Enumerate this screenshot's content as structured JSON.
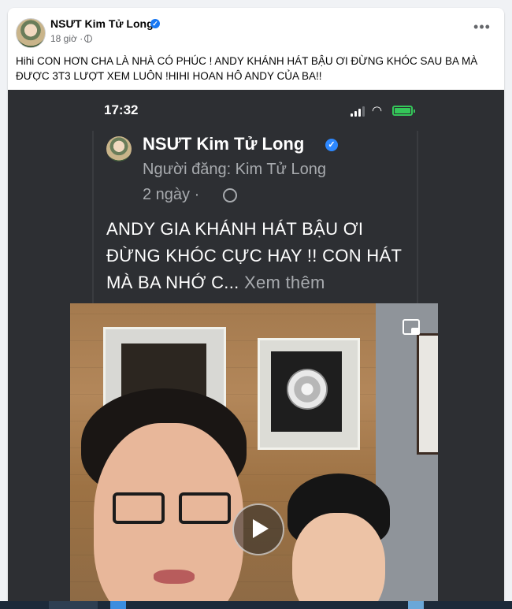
{
  "post": {
    "author": "NSƯT Kim Tử Long",
    "verified_mark": "✓",
    "time": "18 giờ ·",
    "more_label": "•••",
    "caption": "Hihi CON HƠN CHA LÀ NHÀ CÓ PHÚC ! ANDY KHÁNH HÁT BẬU ƠI ĐỪNG KHÓC SAU BA MÀ ĐƯỢC 3T3 LƯỢT XEM LUÔN !HIHI HOAN HÔ ANDY CỦA BA!!"
  },
  "screenshot": {
    "phone_time": "17:32",
    "inner_author": "NSƯT Kim Tử Long",
    "inner_poster": "Người đăng: Kim Tử Long",
    "inner_time": "2 ngày ·",
    "inner_text": "ANDY GIA KHÁNH HÁT BẬU ƠI ĐỪNG KHÓC CỰC HAY !! CON HÁT MÀ BA NHỚ C...",
    "see_more": "Xem thêm"
  },
  "icons": {
    "globe": "globe-icon",
    "verified": "verified-badge-icon",
    "play": "play-icon",
    "pip": "picture-in-picture-icon",
    "signal": "cellular-signal-icon",
    "wifi": "wifi-icon",
    "battery": "battery-charging-icon"
  },
  "colors": {
    "facebook_blue": "#1877f2",
    "battery_green": "#34c759",
    "dark_bg": "#2d2f33"
  }
}
